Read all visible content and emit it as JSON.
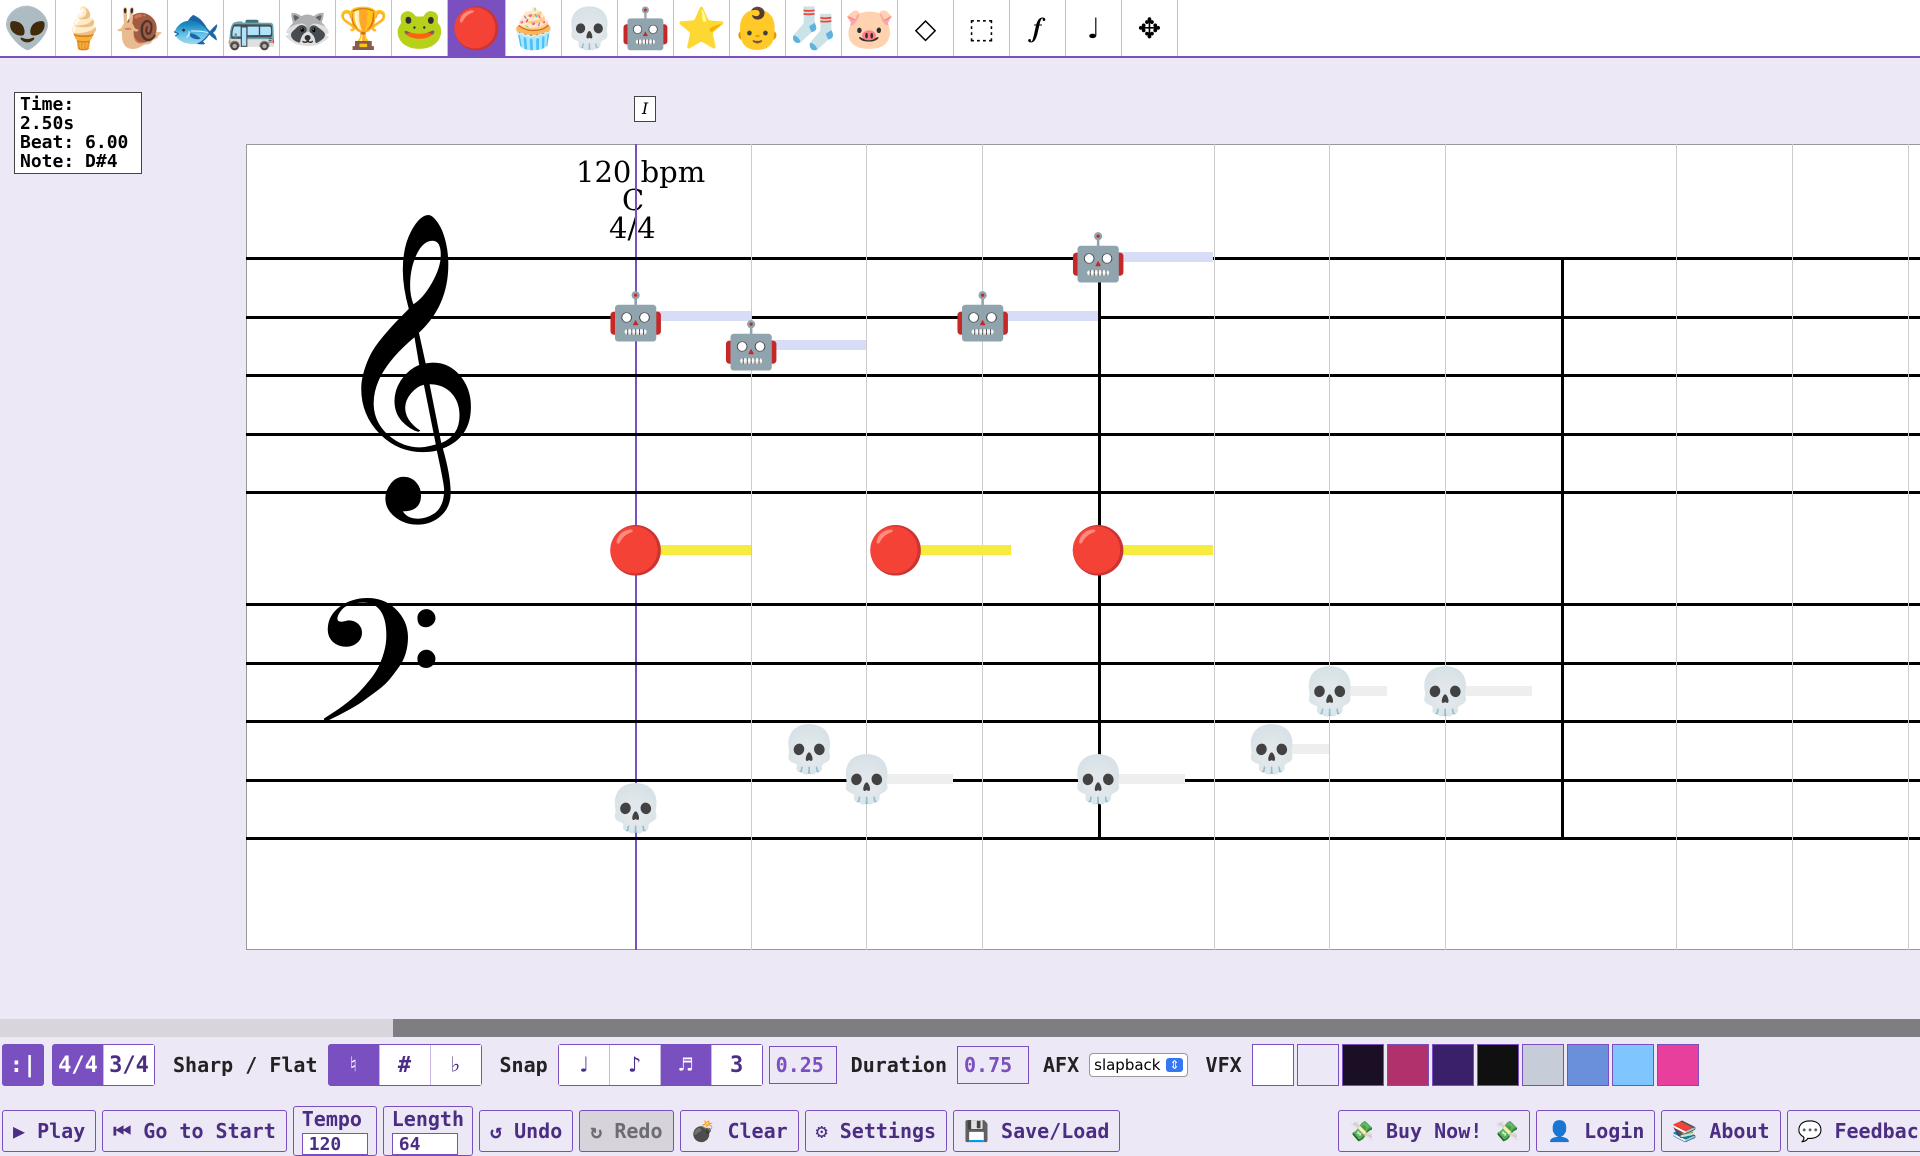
{
  "toolbar": {
    "tools": [
      {
        "name": "alien-icon",
        "glyph": "👽"
      },
      {
        "name": "ice-cream-icon",
        "glyph": "🍦"
      },
      {
        "name": "snail-icon",
        "glyph": "🐌"
      },
      {
        "name": "fish-icon",
        "glyph": "🐟"
      },
      {
        "name": "bus-icon",
        "glyph": "🚌"
      },
      {
        "name": "raccoon-icon",
        "glyph": "🦝"
      },
      {
        "name": "goblet-icon",
        "glyph": "🏆"
      },
      {
        "name": "frog-icon",
        "glyph": "🐸"
      },
      {
        "name": "beach-ball-icon",
        "glyph": "🔴"
      },
      {
        "name": "cupcake-icon",
        "glyph": "🧁"
      },
      {
        "name": "skull-icon",
        "glyph": "💀"
      },
      {
        "name": "robot-icon",
        "glyph": "🤖"
      },
      {
        "name": "star-icon",
        "glyph": "⭐"
      },
      {
        "name": "baby-icon",
        "glyph": "👶"
      },
      {
        "name": "sock-icon",
        "glyph": "🧦"
      },
      {
        "name": "pig-hat-icon",
        "glyph": "🐷"
      },
      {
        "name": "eraser-icon",
        "glyph": "◇"
      },
      {
        "name": "selection-icon",
        "glyph": "⬚"
      },
      {
        "name": "dynamics-icon",
        "glyph": "𝆑"
      },
      {
        "name": "note-length-icon",
        "glyph": "♩"
      },
      {
        "name": "move-icon",
        "glyph": "✥"
      }
    ],
    "active_index": 8
  },
  "info": {
    "time": "Time: 2.50s",
    "beat": "Beat: 6.00",
    "note": "Note: D#4"
  },
  "loop_marker": "I",
  "score_header": {
    "tempo": "120 bpm",
    "key": "C",
    "time_sig": "4/4"
  },
  "clefs": {
    "treble": "𝄞",
    "bass": "𝄢"
  },
  "notes": [
    {
      "icon": "robot-icon",
      "glyph": "🤖",
      "beat": 0,
      "line": "treble-4",
      "len": 1
    },
    {
      "icon": "robot-icon",
      "glyph": "🤖",
      "beat": 1,
      "line": "treble-3.5",
      "len": 1
    },
    {
      "icon": "robot-icon",
      "glyph": "🤖",
      "beat": 3,
      "line": "treble-4",
      "len": 1
    },
    {
      "icon": "robot-icon",
      "glyph": "🤖",
      "beat": 4,
      "line": "treble-5",
      "len": 1
    },
    {
      "icon": "beach-ball-icon",
      "glyph": "🔴",
      "beat": 0,
      "line": "middle-c",
      "len": 1
    },
    {
      "icon": "beach-ball-icon",
      "glyph": "🔴",
      "beat": 2.25,
      "line": "middle-c",
      "len": 1
    },
    {
      "icon": "beach-ball-icon",
      "glyph": "🔴",
      "beat": 4,
      "line": "middle-c",
      "len": 1
    },
    {
      "icon": "skull-icon",
      "glyph": "💀",
      "beat": 0,
      "line": "bass-1.5",
      "len": 0
    },
    {
      "icon": "skull-icon",
      "glyph": "💀",
      "beat": 1.5,
      "line": "bass-2.5",
      "len": 0
    },
    {
      "icon": "skull-icon",
      "glyph": "💀",
      "beat": 2,
      "line": "bass-2",
      "len": 0.75
    },
    {
      "icon": "skull-icon",
      "glyph": "💀",
      "beat": 4,
      "line": "bass-2",
      "len": 0.75
    },
    {
      "icon": "skull-icon",
      "glyph": "💀",
      "beat": 5.5,
      "line": "bass-2.5",
      "len": 0.5
    },
    {
      "icon": "skull-icon",
      "glyph": "💀",
      "beat": 6,
      "line": "bass-3.5",
      "len": 0.5
    },
    {
      "icon": "skull-icon",
      "glyph": "💀",
      "beat": 7,
      "line": "bass-3.5",
      "len": 0.75
    }
  ],
  "colors": {
    "accent": "#7a4fc0",
    "robot_tail": "#d7dcf7",
    "ball_tail": "#f7ec3e",
    "skull_tail": "#eeeeee"
  },
  "bottom": {
    "loop_toggle": ":|",
    "time_sigs": [
      "4/4",
      "3/4"
    ],
    "sharp_flat_label": "Sharp / Flat",
    "accidentals": [
      "♮",
      "#",
      "♭"
    ],
    "snap_label": "Snap",
    "snaps": [
      "♩",
      "♪",
      "♬",
      "3"
    ],
    "snap_value": "0.25",
    "duration_label": "Duration",
    "duration_value": "0.75",
    "afx_label": "AFX",
    "afx_value": "slapback",
    "vfx_label": "VFX",
    "vfx_swatches": [
      "#ffffff",
      "#ece8f5",
      "#1a0f24",
      "#b0316b",
      "#3a1f6b",
      "#101010",
      "#c7cdd8",
      "#6a8fdb",
      "#7fc6ff",
      "#e83f9c"
    ],
    "play": "▶ Play",
    "go_to_start": "⏮ Go to Start",
    "tempo_label": "Tempo",
    "tempo_value": "120",
    "length_label": "Length",
    "length_value": "64",
    "undo": "↺ Undo",
    "redo": "↻ Redo",
    "clear": "💣 Clear",
    "settings": "⚙ Settings",
    "save_load": "💾 Save/Load",
    "buy_now": "💸 Buy Now! 💸",
    "login": "👤 Login",
    "about": "📚 About",
    "feedback": "💬 Feedback"
  }
}
